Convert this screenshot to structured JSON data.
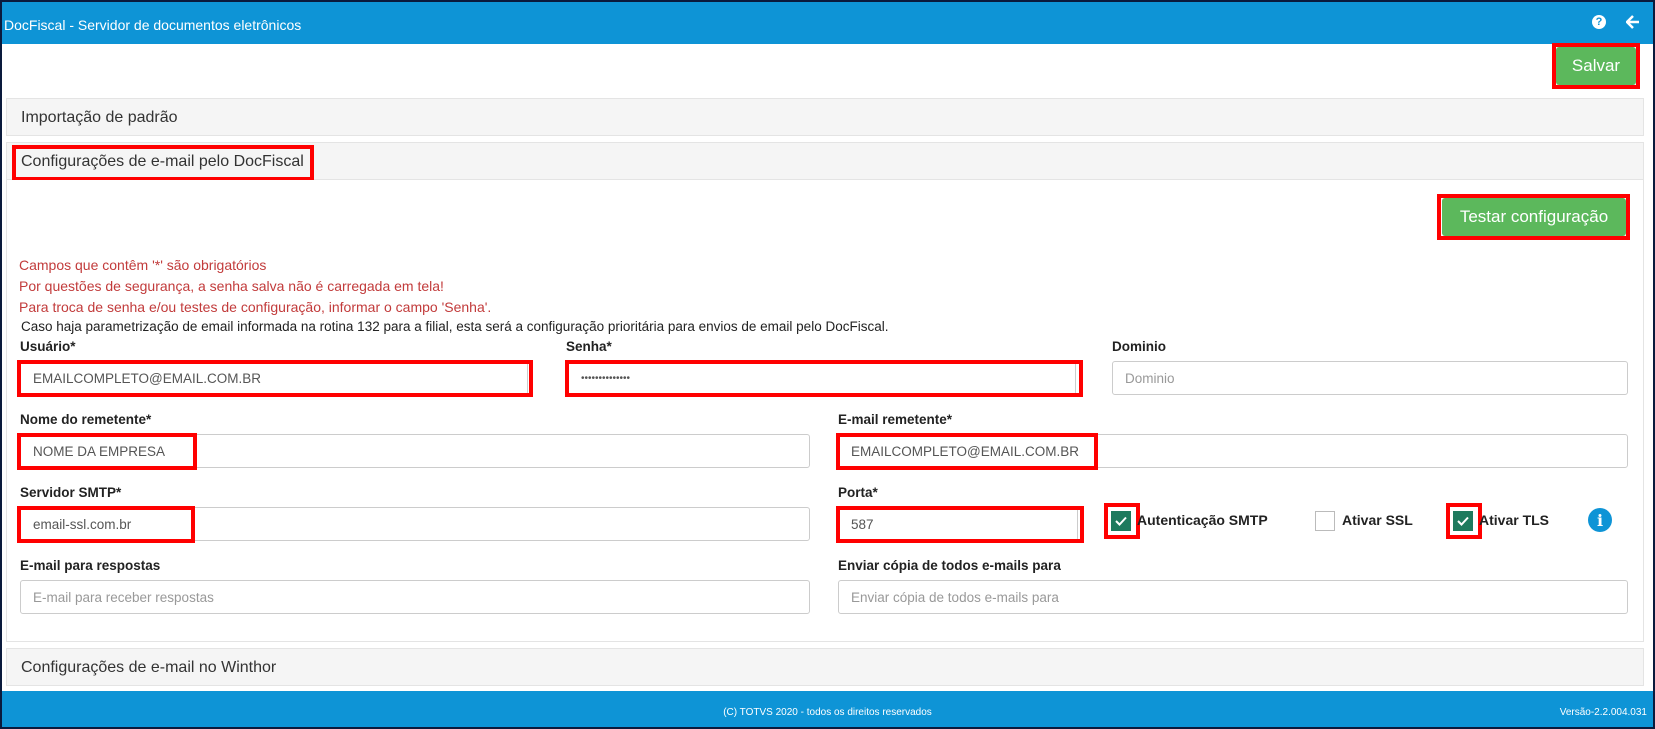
{
  "app": {
    "title": "DocFiscal - Servidor de documentos eletrônicos"
  },
  "toolbar": {
    "save_label": "Salvar",
    "help_icon": "help-icon",
    "back_icon": "arrow-left-icon"
  },
  "panels": {
    "import": "Importação de padrão",
    "email_docfiscal": "Configurações de e-mail pelo DocFiscal",
    "email_winthor": "Configurações de e-mail no Winthor"
  },
  "form": {
    "test_label": "Testar configuração",
    "warnings": [
      "Campos que contêm '*' são obrigatórios",
      "Por questões de segurança, a senha salva não é carregada em tela!",
      "Para troca de senha e/ou testes de configuração, informar o campo 'Senha'."
    ],
    "note": "Caso haja parametrização de email informada na rotina 132 para a filial, esta será a configuração prioritária para envios de email pelo DocFiscal.",
    "usuario": {
      "label": "Usuário*",
      "value": "EMAILCOMPLETO@EMAIL.COM.BR"
    },
    "senha": {
      "label": "Senha*",
      "value": "••••••••••••••"
    },
    "dominio": {
      "label": "Dominio",
      "placeholder": "Dominio"
    },
    "remetente_nome": {
      "label": "Nome do remetente*",
      "value": "NOME DA EMPRESA"
    },
    "remetente_email": {
      "label": "E-mail remetente*",
      "value": "EMAILCOMPLETO@EMAIL.COM.BR"
    },
    "smtp": {
      "label": "Servidor SMTP*",
      "value": "email-ssl.com.br"
    },
    "porta": {
      "label": "Porta*",
      "value": "587"
    },
    "auth_smtp": {
      "label": "Autenticação SMTP",
      "checked": true
    },
    "ssl": {
      "label": "Ativar SSL",
      "checked": false
    },
    "tls": {
      "label": "Ativar TLS",
      "checked": true
    },
    "respostas": {
      "label": "E-mail para respostas",
      "placeholder": "E-mail para receber respostas"
    },
    "copia": {
      "label": "Enviar cópia de todos e-mails para",
      "placeholder": "Enviar cópia de todos e-mails para"
    },
    "info_icon": "info-icon"
  },
  "footer": {
    "copyright": "(C) TOTVS 2020 - todos os direitos reservados",
    "version": "Versão-2.2.004.031"
  },
  "colors": {
    "brand": "#0e94d6",
    "button_green": "#5cb85c",
    "highlight_red": "#ff0000",
    "warning_text": "#c23b3b",
    "checkbox_on": "#1e7a5e"
  }
}
